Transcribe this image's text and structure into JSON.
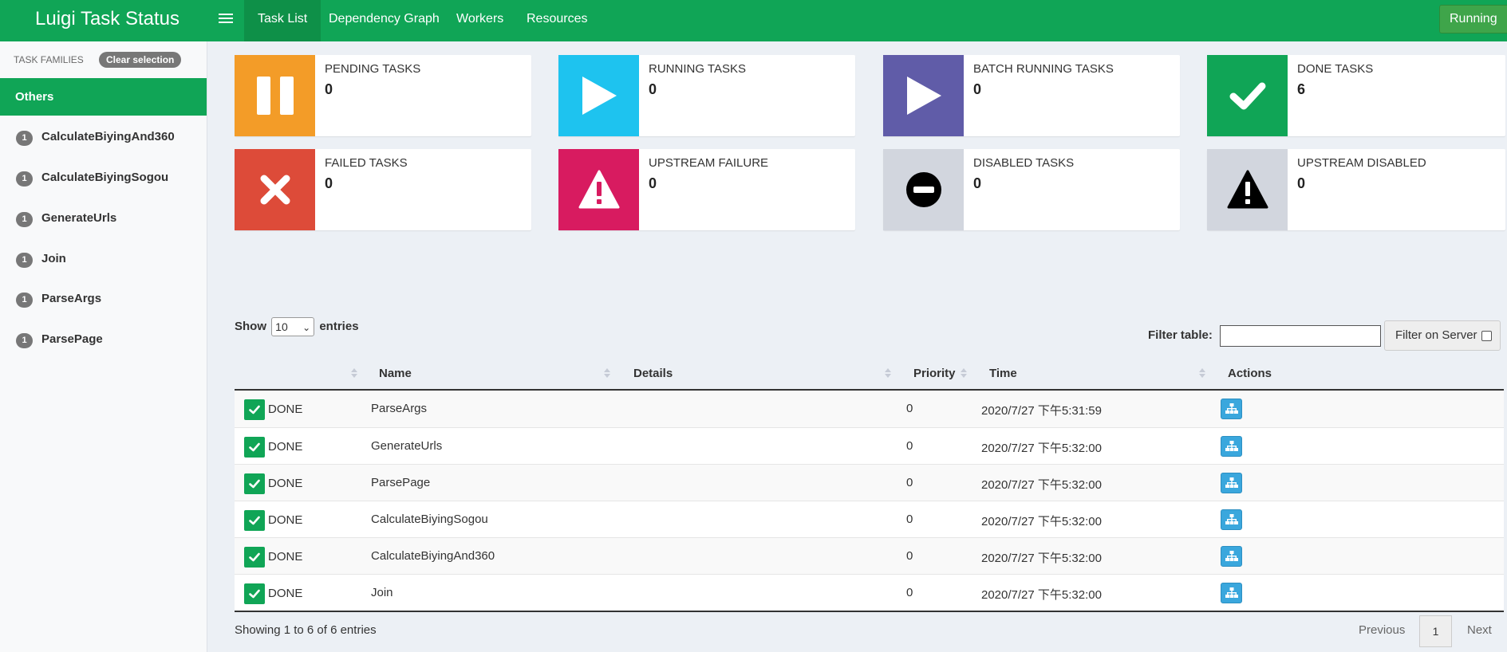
{
  "navbar": {
    "brand": "Luigi Task Status",
    "tabs": [
      {
        "label": "Task List"
      },
      {
        "label": "Dependency Graph"
      },
      {
        "label": "Workers"
      },
      {
        "label": "Resources"
      }
    ],
    "running_label": "Running"
  },
  "sidebar": {
    "header": "TASK FAMILIES",
    "clear_label": "Clear selection",
    "active_group": "Others",
    "items": [
      {
        "count": "1",
        "label": "CalculateBiyingAnd360"
      },
      {
        "count": "1",
        "label": "CalculateBiyingSogou"
      },
      {
        "count": "1",
        "label": "GenerateUrls"
      },
      {
        "count": "1",
        "label": "Join"
      },
      {
        "count": "1",
        "label": "ParseArgs"
      },
      {
        "count": "1",
        "label": "ParsePage"
      }
    ]
  },
  "info_boxes": [
    {
      "label": "PENDING TASKS",
      "value": "0",
      "color": "#f39c28",
      "icon": "pause-icon"
    },
    {
      "label": "RUNNING TASKS",
      "value": "0",
      "color": "#1ec3ef",
      "icon": "play-icon"
    },
    {
      "label": "BATCH RUNNING TASKS",
      "value": "0",
      "color": "#605ca8",
      "icon": "play-icon"
    },
    {
      "label": "DONE TASKS",
      "value": "6",
      "color": "#10a556",
      "icon": "check-icon"
    },
    {
      "label": "FAILED TASKS",
      "value": "0",
      "color": "#dd4b39",
      "icon": "close-icon"
    },
    {
      "label": "UPSTREAM FAILURE",
      "value": "0",
      "color": "#d81b60",
      "icon": "warning-icon"
    },
    {
      "label": "DISABLED TASKS",
      "value": "0",
      "color": "#d2d6de",
      "icon": "minus-circle-icon"
    },
    {
      "label": "UPSTREAM DISABLED",
      "value": "0",
      "color": "#d2d6de",
      "icon": "warning-icon"
    }
  ],
  "table_controls": {
    "show_label": "Show",
    "entries_value": "10",
    "entries_label": "entries",
    "filter_label": "Filter table:",
    "filter_value": "",
    "filter_server_label": "Filter on Server"
  },
  "table": {
    "columns": [
      "Name",
      "Details",
      "Priority",
      "Time",
      "Actions"
    ],
    "rows": [
      {
        "status": "DONE",
        "name": "ParseArgs",
        "details": "",
        "priority": "0",
        "time": "2020/7/27 下午5:31:59"
      },
      {
        "status": "DONE",
        "name": "GenerateUrls",
        "details": "",
        "priority": "0",
        "time": "2020/7/27 下午5:32:00"
      },
      {
        "status": "DONE",
        "name": "ParsePage",
        "details": "",
        "priority": "0",
        "time": "2020/7/27 下午5:32:00"
      },
      {
        "status": "DONE",
        "name": "CalculateBiyingSogou",
        "details": "",
        "priority": "0",
        "time": "2020/7/27 下午5:32:00"
      },
      {
        "status": "DONE",
        "name": "CalculateBiyingAnd360",
        "details": "",
        "priority": "0",
        "time": "2020/7/27 下午5:32:00"
      },
      {
        "status": "DONE",
        "name": "Join",
        "details": "",
        "priority": "0",
        "time": "2020/7/27 下午5:32:00"
      }
    ]
  },
  "footer": {
    "showing": "Showing 1 to 6 of 6 entries",
    "prev_label": "Previous",
    "page": "1",
    "next_label": "Next"
  }
}
